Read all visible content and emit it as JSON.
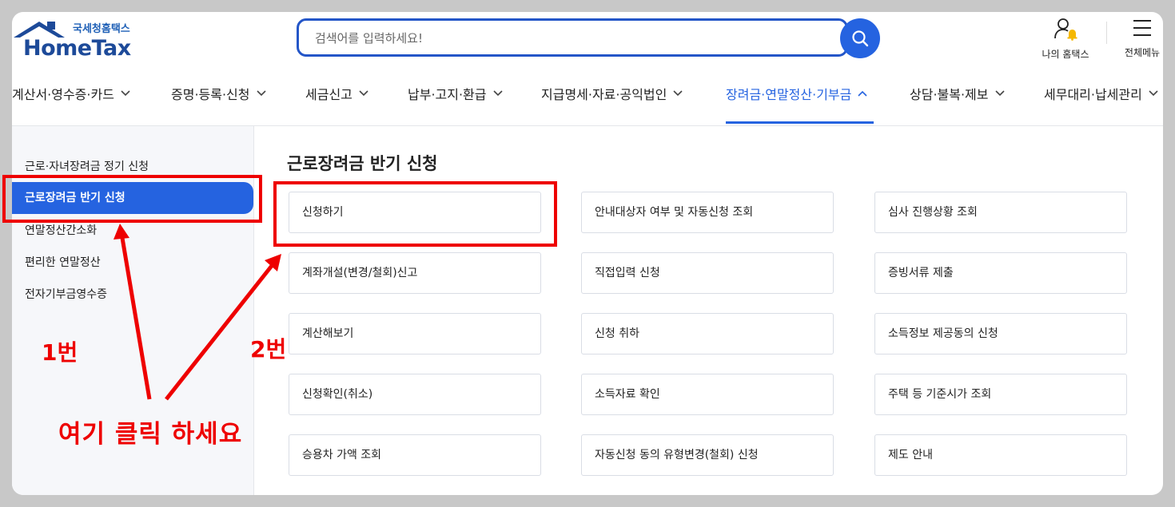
{
  "header": {
    "logo_sub": "국세청홈택스",
    "logo_main": "HomeTax",
    "search_placeholder": "검색어를 입력하세요!",
    "my_hometax": "나의 홈택스",
    "all_menu": "전체메뉴"
  },
  "gnb": [
    {
      "label": "계산서·영수증·카드",
      "active": false
    },
    {
      "label": "증명·등록·신청",
      "active": false
    },
    {
      "label": "세금신고",
      "active": false
    },
    {
      "label": "납부·고지·환급",
      "active": false
    },
    {
      "label": "지급명세·자료·공익법인",
      "active": false
    },
    {
      "label": "장려금·연말정산·기부금",
      "active": true
    },
    {
      "label": "상담·불복·제보",
      "active": false
    },
    {
      "label": "세무대리·납세관리",
      "active": false
    }
  ],
  "sidebar": {
    "items": [
      {
        "label": "근로·자녀장려금 정기 신청"
      },
      {
        "label": "근로장려금 반기 신청",
        "active": true
      },
      {
        "label": "연말정산간소화"
      },
      {
        "label": "편리한 연말정산"
      },
      {
        "label": "전자기부금영수증"
      }
    ]
  },
  "main": {
    "title": "근로장려금 반기 신청",
    "cards": [
      [
        "신청하기",
        "안내대상자 여부 및 자동신청 조회",
        "심사 진행상황 조회"
      ],
      [
        "계좌개설(변경/철회)신고",
        "직접입력 신청",
        "증빙서류 제출"
      ],
      [
        "계산해보기",
        "신청 취하",
        "소득정보 제공동의 신청"
      ],
      [
        "신청확인(취소)",
        "소득자료 확인",
        "주택 등 기준시가 조회"
      ],
      [
        "승용차 가액 조회",
        "자동신청 동의 유형변경(철회) 신청",
        "제도 안내"
      ]
    ]
  },
  "annotations": {
    "label1": "1번",
    "label2": "2번",
    "click_here": "여기 클릭 하세요",
    "color": "#ee0000"
  },
  "colors": {
    "accent": "#2563e0",
    "logo": "#1d4a99"
  }
}
